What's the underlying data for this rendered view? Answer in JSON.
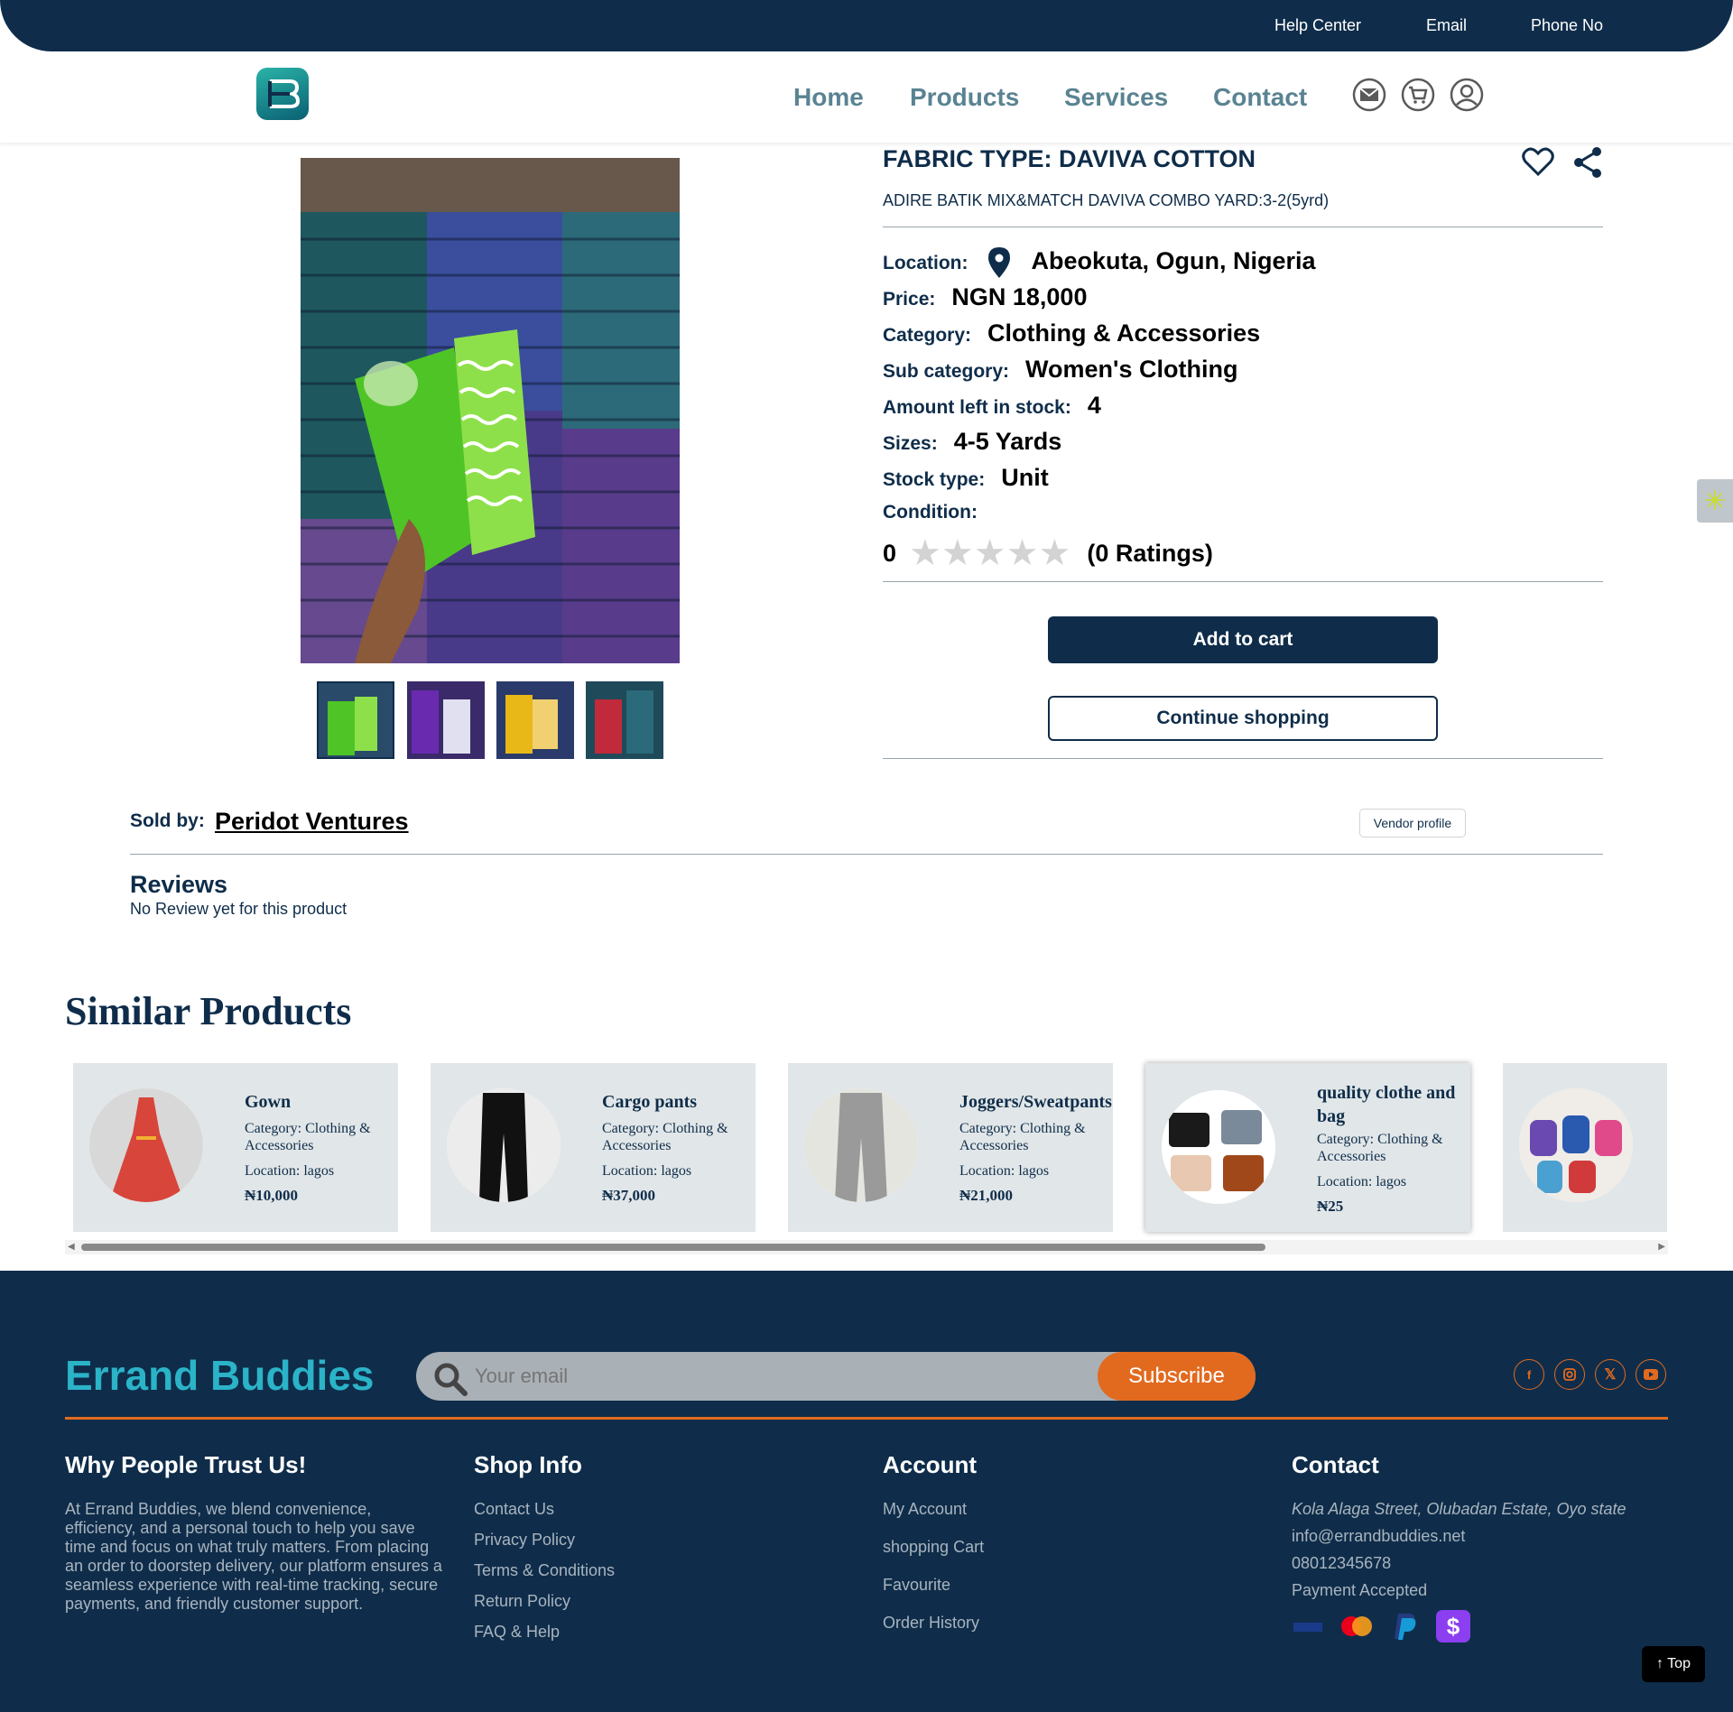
{
  "topbar": {
    "help": "Help Center",
    "email": "Email",
    "phone": "Phone No"
  },
  "nav": {
    "logo_letter": "B",
    "links": [
      "Home",
      "Products",
      "Services",
      "Contact"
    ],
    "icons": [
      "mail-icon",
      "cart-icon",
      "user-icon"
    ]
  },
  "product": {
    "title": "FABRIC TYPE: DAVIVA COTTON",
    "subtitle": "ADIRE BATIK MIX&MATCH DAVIVA COMBO YARD:3-2(5yrd)",
    "location_label": "Location:",
    "location": "Abeokuta, Ogun, Nigeria",
    "price_label": "Price:",
    "price": "NGN 18,000",
    "category_label": "Category:",
    "category": "Clothing & Accessories",
    "subcategory_label": "Sub category:",
    "subcategory": "Women's Clothing",
    "stock_label": "Amount left in stock:",
    "stock": "4",
    "sizes_label": "Sizes:",
    "sizes": "4-5 Yards",
    "stock_type_label": "Stock type:",
    "stock_type": "Unit",
    "condition_label": "Condition:",
    "rating_value": "0",
    "rating_count": "(0 Ratings)",
    "stars_filled": 0,
    "stars_total": 5,
    "add_to_cart": "Add to cart",
    "continue_shopping": "Continue shopping",
    "thumbnails": 4,
    "selected_thumbnail": 1
  },
  "seller": {
    "label": "Sold by:",
    "name": "Peridot Ventures",
    "profile_button": "Vendor profile"
  },
  "reviews": {
    "title": "Reviews",
    "empty": "No Review yet for this product"
  },
  "similar": {
    "title": "Similar Products",
    "items": [
      {
        "name": "Gown",
        "category": "Category: Clothing & Accessories",
        "location": "Location: lagos",
        "price": "₦10,000"
      },
      {
        "name": "Cargo pants",
        "category": "Category: Clothing & Accessories",
        "location": "Location: lagos",
        "price": "₦37,000"
      },
      {
        "name": "Joggers/Sweatpants",
        "category": "Category: Clothing & Accessories",
        "location": "Location: lagos",
        "price": "₦21,000"
      },
      {
        "name": "quality clothe and bag",
        "category": "Category: Clothing & Accessories",
        "location": "Location: lagos",
        "price": "₦25"
      }
    ]
  },
  "footer": {
    "brand": "Errand Buddies",
    "email_placeholder": "Your email",
    "subscribe": "Subscribe",
    "social": [
      "facebook-icon",
      "instagram-icon",
      "x-icon",
      "youtube-icon"
    ],
    "trust_title": "Why People Trust Us!",
    "trust_text": "At Errand Buddies, we blend convenience, efficiency, and a personal touch to help you save time and focus on what truly matters. From placing an order to doorstep delivery, our platform ensures a seamless experience with real-time tracking, secure payments, and friendly customer support.",
    "shop_title": "Shop Info",
    "shop_links": [
      "Contact Us",
      "Privacy Policy",
      "Terms & Conditions",
      "Return Policy",
      "FAQ & Help"
    ],
    "account_title": "Account",
    "account_links": [
      "My Account",
      "shopping Cart",
      "Favourite",
      "Order History"
    ],
    "contact_title": "Contact",
    "address": "Kola Alaga Street, Olubadan Estate, Oyo state",
    "email": "info@errandbuddies.net",
    "phone": "08012345678",
    "payment": "Payment Accepted",
    "top_button": "↑ Top"
  },
  "colors": {
    "navy": "#0f2d4a",
    "accent": "#e26a1f",
    "teal": "#2bb3c8",
    "nav_link": "#5a8392"
  }
}
